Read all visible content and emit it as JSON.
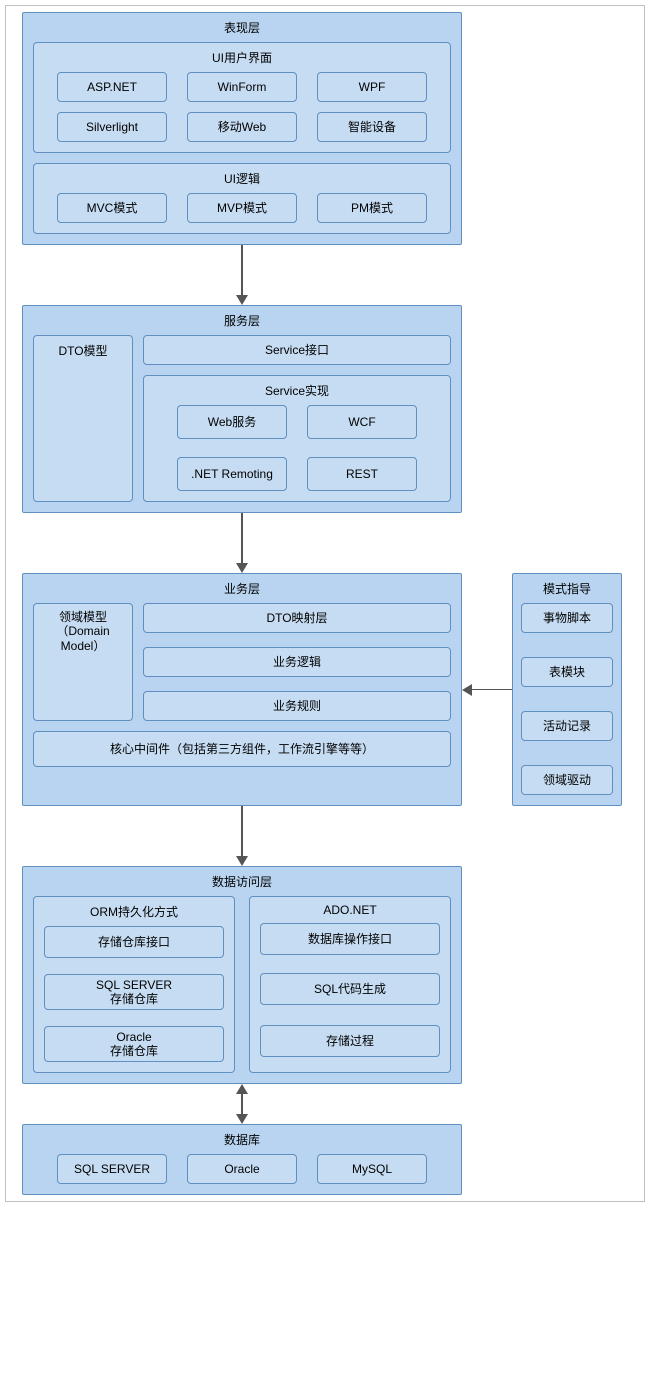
{
  "presentation": {
    "title": "表现层",
    "ui": {
      "title": "UI用户界面",
      "items": [
        "ASP.NET",
        "WinForm",
        "WPF",
        "Silverlight",
        "移动Web",
        "智能设备"
      ]
    },
    "logic": {
      "title": "UI逻辑",
      "items": [
        "MVC模式",
        "MVP模式",
        "PM模式"
      ]
    }
  },
  "service": {
    "title": "服务层",
    "dto": "DTO模型",
    "iface": "Service接口",
    "impl": {
      "title": "Service实现",
      "items": [
        "Web服务",
        "WCF",
        ".NET Remoting",
        "REST"
      ]
    }
  },
  "business": {
    "title": "业务层",
    "domain": "领域模型（Domain Model）",
    "mapping": "DTO映射层",
    "logic": "业务逻辑",
    "rules": "业务规则",
    "middleware": "核心中间件（包括第三方组件，工作流引擎等等）"
  },
  "guide": {
    "title": "模式指导",
    "items": [
      "事物脚本",
      "表模块",
      "活动记录",
      "领域驱动"
    ]
  },
  "dal": {
    "title": "数据访问层",
    "orm": {
      "title": "ORM持久化方式",
      "items": [
        "存储仓库接口",
        "SQL SERVER\n存储仓库",
        "Oracle\n存储仓库"
      ]
    },
    "ado": {
      "title": "ADO.NET",
      "items": [
        "数据库操作接口",
        "SQL代码生成",
        "存储过程"
      ]
    }
  },
  "db": {
    "title": "数据库",
    "items": [
      "SQL SERVER",
      "Oracle",
      "MySQL"
    ]
  }
}
